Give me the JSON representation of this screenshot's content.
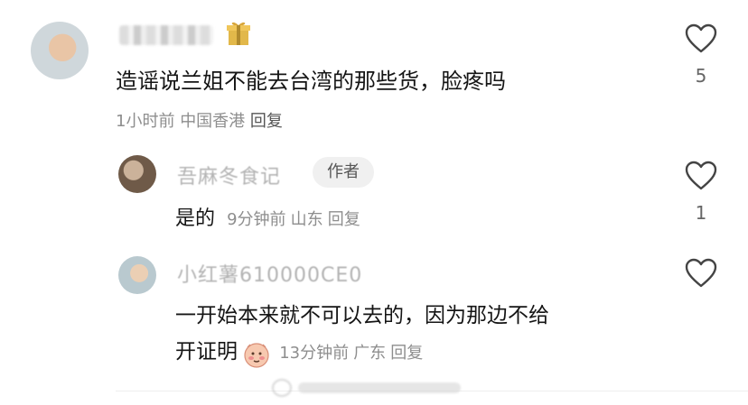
{
  "comment1": {
    "text": "造谣说兰姐不能去台湾的那些货，脸疼吗",
    "time": "1小时前",
    "location": "中国香港",
    "reply": "回复",
    "likes": "5"
  },
  "comment2": {
    "username": "吾麻冬食记",
    "badge": "作者",
    "text": "是的",
    "time": "9分钟前",
    "location": "山东",
    "reply": "回复",
    "likes": "1"
  },
  "comment3": {
    "username": "小红薯610000CE0",
    "text_line1": "一开始本来就不可以去的，因为那边不给",
    "text_line2": "开证明",
    "time": "13分钟前",
    "location": "广东",
    "reply": "回复",
    "emoji": "embarrassed-face-emoji"
  },
  "colors": {
    "text": "#151515",
    "meta": "#8e8e8e",
    "badge_bg": "#f0f0f0"
  }
}
